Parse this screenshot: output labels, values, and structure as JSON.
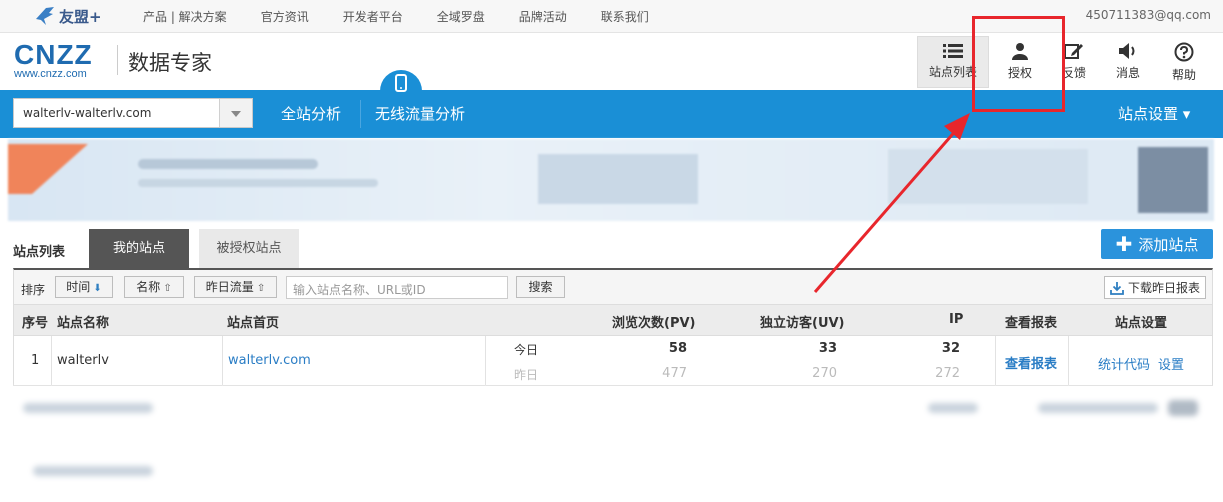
{
  "topbar": {
    "brand": "友盟+",
    "links": [
      "产品 | 解决方案",
      "官方资讯",
      "开发者平台",
      "全域罗盘",
      "品牌活动",
      "联系我们"
    ],
    "user_email": "450711383@qq.com"
  },
  "header": {
    "logo_main": "CNZZ",
    "logo_sub": "www.cnzz.com",
    "product_title": "数据专家",
    "buttons": [
      {
        "label": "站点列表",
        "icon": "list-icon",
        "active": true
      },
      {
        "label": "授权",
        "icon": "user-icon",
        "active": false
      },
      {
        "label": "反馈",
        "icon": "edit-icon",
        "active": false
      },
      {
        "label": "消息",
        "icon": "speaker-icon",
        "active": false
      },
      {
        "label": "帮助",
        "icon": "help-icon",
        "active": false
      }
    ]
  },
  "nav": {
    "site_select_value": "walterlv-walterlv.com",
    "items": [
      "全站分析",
      "无线流量分析"
    ],
    "settings": "站点设置 ▾"
  },
  "site_list": {
    "section_label": "站点列表",
    "tabs": [
      "我的站点",
      "被授权站点"
    ],
    "add_button": "添加站点",
    "sort_label": "排序",
    "sort_buttons": [
      "时间",
      "名称",
      "昨日流量"
    ],
    "search_placeholder": "输入站点名称、URL或ID",
    "search_button": "搜索",
    "download_button": "下载昨日报表",
    "columns": [
      "序号",
      "站点名称",
      "站点首页",
      "浏览次数(PV)",
      "独立访客(UV)",
      "IP",
      "查看报表",
      "站点设置"
    ],
    "rows": [
      {
        "index": "1",
        "name": "walterlv",
        "homepage": "walterlv.com",
        "today_label": "今日",
        "yesterday_label": "昨日",
        "pv_today": "58",
        "pv_yesterday": "477",
        "uv_today": "33",
        "uv_yesterday": "270",
        "ip_today": "32",
        "ip_yesterday": "272",
        "report_link": "查看报表",
        "code_link": "统计代码",
        "settings_link": "设置"
      }
    ]
  },
  "colors": {
    "nav_blue": "#1a8fd6",
    "link_blue": "#2a7dc5",
    "annotation_red": "#e8262c"
  }
}
